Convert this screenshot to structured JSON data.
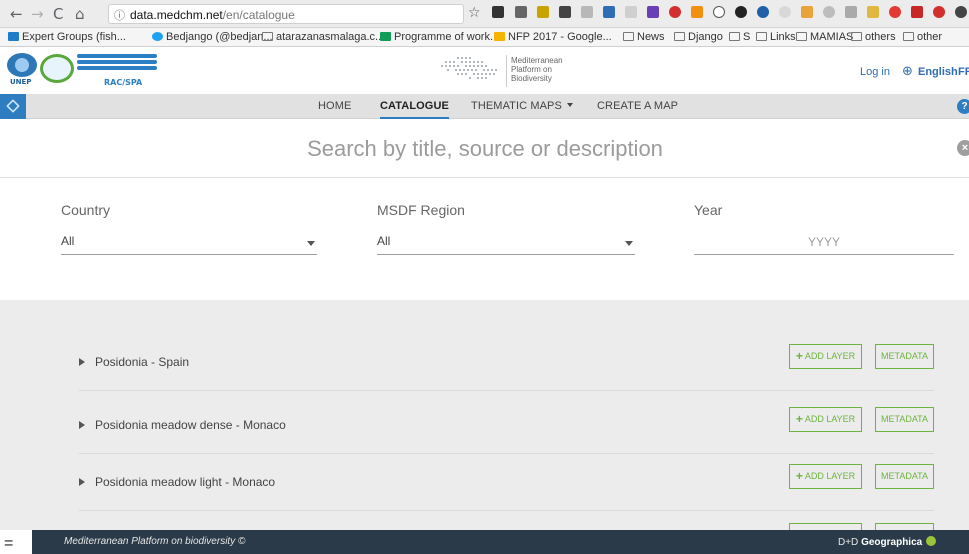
{
  "browser": {
    "url_host": "data.medchm.net",
    "url_path": "/en/catalogue",
    "bookmarks": [
      "Expert Groups (fish...",
      "Bedjango (@bedjan...",
      "atarazanasmalaga.c...",
      "Programme of work...",
      "NFP 2017 - Google...",
      "News",
      "Django",
      "S",
      "Links",
      "MAMIAS",
      "others",
      "other"
    ]
  },
  "header": {
    "unep_label": "UNEP",
    "rac_label": "RAC/SPA",
    "platform_line1": "Mediterranean",
    "platform_line2": "Platform on",
    "platform_line3": "Biodiversity",
    "login": "Log in",
    "language": "English",
    "language_alt": "FR"
  },
  "nav": {
    "items": [
      "HOME",
      "CATALOGUE",
      "THEMATIC MAPS",
      "CREATE A MAP"
    ],
    "active": "CATALOGUE",
    "help": "?"
  },
  "search": {
    "placeholder": "Search by title, source or description",
    "clear": "×"
  },
  "filters": {
    "country_label": "Country",
    "country_value": "All",
    "region_label": "MSDF Region",
    "region_value": "All",
    "year_label": "Year",
    "year_placeholder": "YYYY"
  },
  "results": {
    "add_label": "ADD LAYER",
    "metadata_label": "METADATA",
    "items": [
      "Posidonia - Spain",
      "Posidonia meadow dense - Monaco",
      "Posidonia meadow light - Monaco"
    ]
  },
  "footer": {
    "text": "Mediterranean Platform on biodiversity ©",
    "brand_prefix": "D+D",
    "brand_name": "Geographica"
  },
  "colors": {
    "accent_blue": "#2f7dc1",
    "button_green": "#6db33f",
    "footer_bg": "#2a3a48"
  }
}
